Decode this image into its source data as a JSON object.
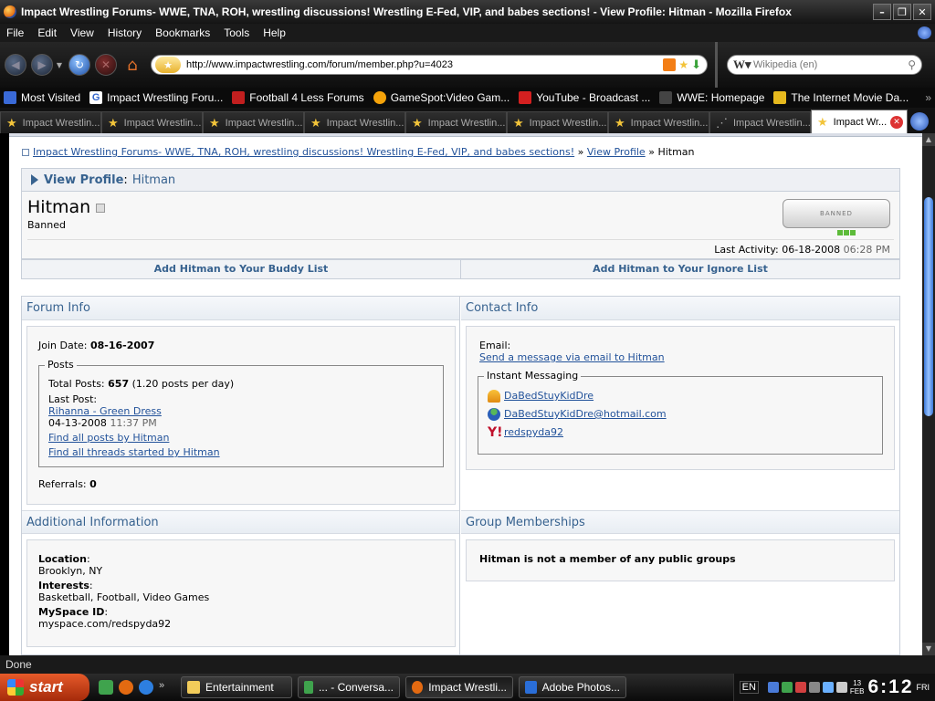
{
  "window": {
    "title": "Impact Wrestling Forums- WWE, TNA, ROH, wrestling discussions! Wrestling E-Fed, VIP, and babes sections! - View Profile: Hitman - Mozilla Firefox"
  },
  "menu": [
    "File",
    "Edit",
    "View",
    "History",
    "Bookmarks",
    "Tools",
    "Help"
  ],
  "nav": {
    "url": "http://www.impactwrestling.com/forum/member.php?u=4023",
    "search_placeholder": "Wikipedia (en)"
  },
  "bookmarks": [
    {
      "label": "Most Visited",
      "icon": "most-visited-icon",
      "color": "#3a6ad8"
    },
    {
      "label": "Impact Wrestling Foru...",
      "icon": "google-icon",
      "color": "#ffffff"
    },
    {
      "label": "Football 4 Less Forums",
      "icon": "football-icon",
      "color": "#c21f1f"
    },
    {
      "label": "GameSpot:Video Gam...",
      "icon": "gamespot-icon",
      "color": "#f5a30a"
    },
    {
      "label": "YouTube - Broadcast ...",
      "icon": "youtube-icon",
      "color": "#d42020"
    },
    {
      "label": "WWE: Homepage",
      "icon": "wwe-icon",
      "color": "#444444"
    },
    {
      "label": "The Internet Movie Da...",
      "icon": "imdb-icon",
      "color": "#e6b91e"
    }
  ],
  "tabs": [
    {
      "label": "Impact Wrestlin..."
    },
    {
      "label": "Impact Wrestlin..."
    },
    {
      "label": "Impact Wrestlin..."
    },
    {
      "label": "Impact Wrestlin..."
    },
    {
      "label": "Impact Wrestlin..."
    },
    {
      "label": "Impact Wrestlin..."
    },
    {
      "label": "Impact Wrestlin..."
    },
    {
      "label": "Impact Wrestlin..."
    },
    {
      "label": "Impact Wr..."
    }
  ],
  "breadcrumb": {
    "forum": "Impact Wrestling Forums- WWE, TNA, ROH, wrestling discussions! Wrestling E-Fed, VIP, and babes sections!",
    "sep1": "»",
    "view_profile": "View Profile",
    "sep2": "»",
    "current": "Hitman"
  },
  "profile": {
    "header_label": "View Profile",
    "header_colon": ":",
    "header_user": "Hitman",
    "username": "Hitman",
    "usertitle": "Banned",
    "badge_text": "BANNED",
    "last_activity_label": "Last Activity:",
    "last_activity_date": "06-18-2008",
    "last_activity_time": "06:28 PM",
    "add_buddy": "Add Hitman to Your Buddy List",
    "add_ignore": "Add Hitman to Your Ignore List"
  },
  "forum_info": {
    "heading": "Forum Info",
    "join_label": "Join Date:",
    "join_date": "08-16-2007",
    "posts_legend": "Posts",
    "total_posts_label": "Total Posts:",
    "total_posts": "657",
    "posts_per_day": "(1.20 posts per day)",
    "last_post_label": "Last Post:",
    "last_post_title": "Rihanna - Green Dress",
    "last_post_date": "04-13-2008",
    "last_post_time": "11:37 PM",
    "find_posts": "Find all posts by Hitman",
    "find_threads": "Find all threads started by Hitman",
    "referrals_label": "Referrals:",
    "referrals": "0"
  },
  "contact_info": {
    "heading": "Contact Info",
    "email_label": "Email:",
    "email_link": "Send a message via email to Hitman",
    "im_legend": "Instant Messaging",
    "im": [
      {
        "service_icon": "aim-icon",
        "handle": "DaBedStuyKidDre"
      },
      {
        "service_icon": "msn-icon",
        "handle": "DaBedStuyKidDre@hotmail.com"
      },
      {
        "service_icon": "yahoo-icon",
        "handle": "redspyda92"
      }
    ]
  },
  "additional_info": {
    "heading": "Additional Information",
    "location_label": "Location",
    "location": "Brooklyn, NY",
    "interests_label": "Interests",
    "interests": "Basketball, Football, Video Games",
    "myspace_label": "MySpace ID",
    "myspace": "myspace.com/redspyda92",
    "colon": ":"
  },
  "groups": {
    "heading": "Group Memberships",
    "text": "Hitman is not a member of any public groups"
  },
  "status": {
    "text": "Done"
  },
  "taskbar": {
    "start": "start",
    "tasks": [
      {
        "label": "Entertainment",
        "icon": "folder-icon"
      },
      {
        "label": "... - Conversa...",
        "icon": "messenger-icon"
      },
      {
        "label": "Impact Wrestli...",
        "icon": "firefox-icon"
      },
      {
        "label": "Adobe Photos...",
        "icon": "photoshop-icon"
      }
    ],
    "lang": "EN",
    "date_day": "13",
    "date_month": "FEB",
    "time": "6:12",
    "weekday": "FRI"
  },
  "colors": {
    "link": "#22529a",
    "heading": "#37628f",
    "accent_bg": "#eef0f4"
  }
}
